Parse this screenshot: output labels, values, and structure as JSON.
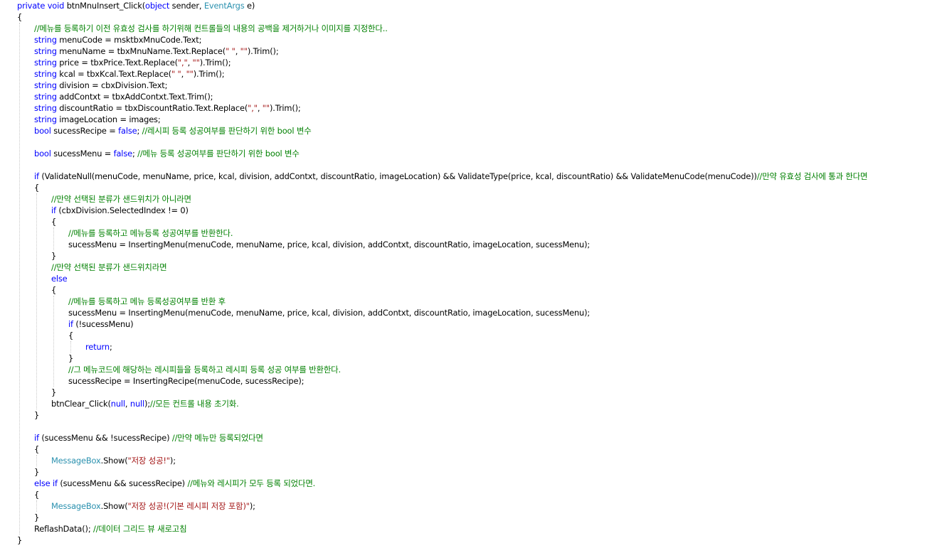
{
  "editor": {
    "font_size_hint": "11px",
    "colors": {
      "keyword": "#0000ff",
      "type": "#2b91af",
      "comment": "#008000",
      "string": "#a31515",
      "plain": "#000000",
      "background": "#ffffff",
      "guide": "#c8c8c8"
    },
    "lines": [
      {
        "indent": 0,
        "tokens": [
          [
            "kw",
            "private"
          ],
          [
            "pl",
            " "
          ],
          [
            "kw",
            "void"
          ],
          [
            "pl",
            " btnMnuInsert_Click("
          ],
          [
            "kw",
            "object"
          ],
          [
            "pl",
            " sender, "
          ],
          [
            "ty",
            "EventArgs"
          ],
          [
            "pl",
            " e)"
          ]
        ]
      },
      {
        "indent": 0,
        "tokens": [
          [
            "pl",
            "{"
          ]
        ]
      },
      {
        "indent": 1,
        "tokens": [
          [
            "cm",
            "//메뉴를 등록하기 이전 유효성 검사를 하기위해 컨트롤들의 내용의 공백을 제거하거나 이미지를 지정한다.."
          ]
        ]
      },
      {
        "indent": 1,
        "tokens": [
          [
            "kw",
            "string"
          ],
          [
            "pl",
            " menuCode = msktbxMnuCode.Text;"
          ]
        ]
      },
      {
        "indent": 1,
        "tokens": [
          [
            "kw",
            "string"
          ],
          [
            "pl",
            " menuName = tbxMnuName.Text.Replace("
          ],
          [
            "st",
            "\" \""
          ],
          [
            "pl",
            ", "
          ],
          [
            "st",
            "\"\""
          ],
          [
            "pl",
            ").Trim();"
          ]
        ]
      },
      {
        "indent": 1,
        "tokens": [
          [
            "kw",
            "string"
          ],
          [
            "pl",
            " price = tbxPrice.Text.Replace("
          ],
          [
            "st",
            "\",\""
          ],
          [
            "pl",
            ", "
          ],
          [
            "st",
            "\"\""
          ],
          [
            "pl",
            ").Trim();"
          ]
        ]
      },
      {
        "indent": 1,
        "tokens": [
          [
            "kw",
            "string"
          ],
          [
            "pl",
            " kcal = tbxKcal.Text.Replace("
          ],
          [
            "st",
            "\" \""
          ],
          [
            "pl",
            ", "
          ],
          [
            "st",
            "\"\""
          ],
          [
            "pl",
            ").Trim();"
          ]
        ]
      },
      {
        "indent": 1,
        "tokens": [
          [
            "kw",
            "string"
          ],
          [
            "pl",
            " division = cbxDivision.Text;"
          ]
        ]
      },
      {
        "indent": 1,
        "tokens": [
          [
            "kw",
            "string"
          ],
          [
            "pl",
            " addContxt = tbxAddContxt.Text.Trim();"
          ]
        ]
      },
      {
        "indent": 1,
        "tokens": [
          [
            "kw",
            "string"
          ],
          [
            "pl",
            " discountRatio = tbxDiscountRatio.Text.Replace("
          ],
          [
            "st",
            "\",\""
          ],
          [
            "pl",
            ", "
          ],
          [
            "st",
            "\"\""
          ],
          [
            "pl",
            ").Trim();"
          ]
        ]
      },
      {
        "indent": 1,
        "tokens": [
          [
            "kw",
            "string"
          ],
          [
            "pl",
            " imageLocation = images;"
          ]
        ]
      },
      {
        "indent": 1,
        "tokens": [
          [
            "kw",
            "bool"
          ],
          [
            "pl",
            " sucessRecipe = "
          ],
          [
            "kw",
            "false"
          ],
          [
            "pl",
            "; "
          ],
          [
            "cm",
            "//레시피 등록 성공여부를 판단하기 위한 bool 변수"
          ]
        ]
      },
      {
        "indent": 1,
        "tokens": []
      },
      {
        "indent": 1,
        "tokens": [
          [
            "kw",
            "bool"
          ],
          [
            "pl",
            " sucessMenu = "
          ],
          [
            "kw",
            "false"
          ],
          [
            "pl",
            "; "
          ],
          [
            "cm",
            "//메뉴 등록 성공여부를 판단하기 위한 bool 변수"
          ]
        ]
      },
      {
        "indent": 1,
        "tokens": []
      },
      {
        "indent": 1,
        "tokens": [
          [
            "kw",
            "if"
          ],
          [
            "pl",
            " (ValidateNull(menuCode, menuName, price, kcal, division, addContxt, discountRatio, imageLocation) && ValidateType(price, kcal, discountRatio) && ValidateMenuCode(menuCode))"
          ],
          [
            "cm",
            "//만약 유효성 검사에 통과 한다면"
          ]
        ]
      },
      {
        "indent": 1,
        "tokens": [
          [
            "pl",
            "{"
          ]
        ]
      },
      {
        "indent": 2,
        "tokens": [
          [
            "cm",
            "//만약 선택된 분류가 샌드위치가 아니라면"
          ]
        ]
      },
      {
        "indent": 2,
        "tokens": [
          [
            "kw",
            "if"
          ],
          [
            "pl",
            " (cbxDivision.SelectedIndex != 0)"
          ]
        ]
      },
      {
        "indent": 2,
        "tokens": [
          [
            "pl",
            "{"
          ]
        ]
      },
      {
        "indent": 3,
        "tokens": [
          [
            "cm",
            "//메뉴를 등록하고 메뉴등록 성공여부를 반환한다."
          ]
        ]
      },
      {
        "indent": 3,
        "tokens": [
          [
            "pl",
            "sucessMenu = InsertingMenu(menuCode, menuName, price, kcal, division, addContxt, discountRatio, imageLocation, sucessMenu);"
          ]
        ]
      },
      {
        "indent": 2,
        "tokens": [
          [
            "pl",
            "}"
          ]
        ]
      },
      {
        "indent": 2,
        "tokens": [
          [
            "cm",
            "//만약 선택된 분류가 샌드위치라면"
          ]
        ]
      },
      {
        "indent": 2,
        "tokens": [
          [
            "kw",
            "else"
          ]
        ]
      },
      {
        "indent": 2,
        "tokens": [
          [
            "pl",
            "{"
          ]
        ]
      },
      {
        "indent": 3,
        "tokens": [
          [
            "cm",
            "//메뉴를 등록하고 메뉴 등록성공여부를 반환 후"
          ]
        ]
      },
      {
        "indent": 3,
        "tokens": [
          [
            "pl",
            "sucessMenu = InsertingMenu(menuCode, menuName, price, kcal, division, addContxt, discountRatio, imageLocation, sucessMenu);"
          ]
        ]
      },
      {
        "indent": 3,
        "tokens": [
          [
            "kw",
            "if"
          ],
          [
            "pl",
            " (!sucessMenu)"
          ]
        ]
      },
      {
        "indent": 3,
        "tokens": [
          [
            "pl",
            "{"
          ]
        ]
      },
      {
        "indent": 4,
        "tokens": [
          [
            "kw",
            "return"
          ],
          [
            "pl",
            ";"
          ]
        ]
      },
      {
        "indent": 3,
        "tokens": [
          [
            "pl",
            "}"
          ]
        ]
      },
      {
        "indent": 3,
        "tokens": [
          [
            "cm",
            "//그 메뉴코드에 해당하는 레시피들을 등록하고 레시피 등록 성공 여부를 반환한다."
          ]
        ]
      },
      {
        "indent": 3,
        "tokens": [
          [
            "pl",
            "sucessRecipe = InsertingRecipe(menuCode, sucessRecipe);"
          ]
        ]
      },
      {
        "indent": 2,
        "tokens": [
          [
            "pl",
            "}"
          ]
        ]
      },
      {
        "indent": 2,
        "tokens": [
          [
            "pl",
            "btnClear_Click("
          ],
          [
            "kw",
            "null"
          ],
          [
            "pl",
            ", "
          ],
          [
            "kw",
            "null"
          ],
          [
            "pl",
            ");"
          ],
          [
            "cm",
            "//모든 컨트롤 내용 초기화."
          ]
        ]
      },
      {
        "indent": 1,
        "tokens": [
          [
            "pl",
            "}"
          ]
        ]
      },
      {
        "indent": 1,
        "tokens": []
      },
      {
        "indent": 1,
        "tokens": [
          [
            "kw",
            "if"
          ],
          [
            "pl",
            " (sucessMenu && !sucessRecipe) "
          ],
          [
            "cm",
            "//만약 메뉴만 등록되었다면"
          ]
        ]
      },
      {
        "indent": 1,
        "tokens": [
          [
            "pl",
            "{"
          ]
        ]
      },
      {
        "indent": 2,
        "tokens": [
          [
            "ty",
            "MessageBox"
          ],
          [
            "pl",
            ".Show("
          ],
          [
            "st",
            "\"저장 성공!\""
          ],
          [
            "pl",
            ");"
          ]
        ]
      },
      {
        "indent": 1,
        "tokens": [
          [
            "pl",
            "}"
          ]
        ]
      },
      {
        "indent": 1,
        "tokens": [
          [
            "kw",
            "else"
          ],
          [
            "pl",
            " "
          ],
          [
            "kw",
            "if"
          ],
          [
            "pl",
            " (sucessMenu && sucessRecipe) "
          ],
          [
            "cm",
            "//메뉴와 레시피가 모두 등록 되었다면."
          ]
        ]
      },
      {
        "indent": 1,
        "tokens": [
          [
            "pl",
            "{"
          ]
        ]
      },
      {
        "indent": 2,
        "tokens": [
          [
            "ty",
            "MessageBox"
          ],
          [
            "pl",
            ".Show("
          ],
          [
            "st",
            "\"저장 성공!(기본 레시피 저장 포함)\""
          ],
          [
            "pl",
            ");"
          ]
        ]
      },
      {
        "indent": 1,
        "tokens": [
          [
            "pl",
            "}"
          ]
        ]
      },
      {
        "indent": 1,
        "tokens": [
          [
            "pl",
            "ReflashData(); "
          ],
          [
            "cm",
            "//데이터 그리드 뷰 새로고침"
          ]
        ]
      },
      {
        "indent": 0,
        "tokens": [
          [
            "pl",
            "}"
          ]
        ]
      }
    ]
  }
}
